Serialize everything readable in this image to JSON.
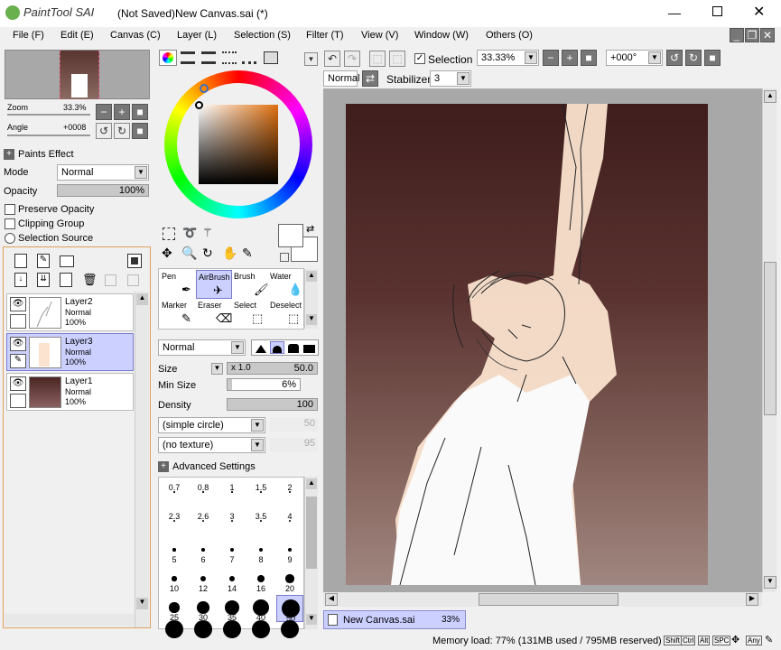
{
  "title_bar": {
    "logo": "PaintTool SAI",
    "title": "(Not Saved)New Canvas.sai (*)"
  },
  "menu": [
    "File (F)",
    "Edit (E)",
    "Canvas (C)",
    "Layer (L)",
    "Selection (S)",
    "Filter (T)",
    "View (V)",
    "Window (W)",
    "Others (O)"
  ],
  "navigator": {
    "zoom_label": "Zoom",
    "zoom_value": "33.3%",
    "angle_label": "Angle",
    "angle_value": "+0008"
  },
  "paints_effect": {
    "label": "Paints Effect",
    "mode_label": "Mode",
    "mode_value": "Normal",
    "opacity_label": "Opacity",
    "opacity_value": "100%",
    "preserve_opacity": "Preserve Opacity",
    "clipping_group": "Clipping Group",
    "selection_source": "Selection Source"
  },
  "layers": [
    {
      "name": "Layer2",
      "mode": "Normal",
      "opacity": "100%"
    },
    {
      "name": "Layer3",
      "mode": "Normal",
      "opacity": "100%"
    },
    {
      "name": "Layer1",
      "mode": "Normal",
      "opacity": "100%"
    }
  ],
  "tools": [
    {
      "label": "Pen"
    },
    {
      "label": "AirBrush"
    },
    {
      "label": "Brush"
    },
    {
      "label": "Water"
    },
    {
      "label": "Marker"
    },
    {
      "label": "Eraser"
    },
    {
      "label": "Select"
    },
    {
      "label": "Deselect"
    }
  ],
  "brush": {
    "blend_mode": "Normal",
    "size_label": "Size",
    "size_mult": "x 1.0",
    "size_value": "50.0",
    "min_size_label": "Min Size",
    "min_size_value": "6%",
    "density_label": "Density",
    "density_value": "100",
    "shape": "(simple circle)",
    "shape_value": "50",
    "texture": "(no texture)",
    "texture_value": "95",
    "advanced": "Advanced Settings"
  },
  "brush_sizes": [
    "0.7",
    "0.8",
    "1",
    "1.5",
    "2",
    "2.3",
    "2.6",
    "3",
    "3.5",
    "4",
    "5",
    "6",
    "7",
    "8",
    "9",
    "10",
    "12",
    "14",
    "16",
    "20",
    "25",
    "30",
    "35",
    "40",
    "50"
  ],
  "toolbar": {
    "selection_label": "Selection",
    "zoom_value": "33.33%",
    "angle_value": "+000°",
    "mode_value": "Normal",
    "stabilizer_label": "Stabilizer",
    "stabilizer_value": "3"
  },
  "canvas_tab": {
    "name": "New Canvas.sai",
    "zoom": "33%"
  },
  "status": {
    "memory": "Memory load: 77% (131MB used / 795MB reserved)",
    "keys": [
      "Shift",
      "Ctrl",
      "Alt",
      "SPC",
      "Any"
    ]
  }
}
